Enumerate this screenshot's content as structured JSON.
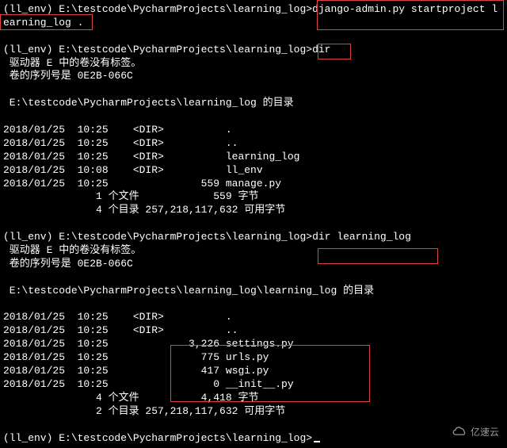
{
  "prompt1_prefix": "(ll_env) E:\\testcode\\PycharmProjects\\learning_log>",
  "cmd1": "django-admin.py startproject l",
  "cmd1_wrap": "earning_log .",
  "prompt2_prefix": "(ll_env) E:\\testcode\\PycharmProjects\\learning_log>",
  "cmd2": "dir",
  "vol_info1": " 驱动器 E 中的卷没有标签。",
  "vol_info2": " 卷的序列号是 0E2B-066C",
  "dir_header1": " E:\\testcode\\PycharmProjects\\learning_log 的目录",
  "listing1": {
    "r1": "2018/01/25  10:25    <DIR>          .",
    "r2": "2018/01/25  10:25    <DIR>          ..",
    "r3": "2018/01/25  10:25    <DIR>          learning_log",
    "r4": "2018/01/25  10:08    <DIR>          ll_env",
    "r5": "2018/01/25  10:25               559 manage.py",
    "summary1": "               1 个文件            559 字节",
    "summary2": "               4 个目录 257,218,117,632 可用字节"
  },
  "prompt3_prefix": "(ll_env) E:\\testcode\\PycharmProjects\\learning_log>",
  "cmd3": "dir learning_log",
  "dir_header2": " E:\\testcode\\PycharmProjects\\learning_log\\learning_log 的目录",
  "listing2": {
    "r1": "2018/01/25  10:25    <DIR>          .",
    "r2": "2018/01/25  10:25    <DIR>          ..",
    "r3": "2018/01/25  10:25             3,226 settings.py",
    "r4": "2018/01/25  10:25               775 urls.py",
    "r5": "2018/01/25  10:25               417 wsgi.py",
    "r6": "2018/01/25  10:25                 0 __init__.py",
    "summary1": "               4 个文件          4,418 字节",
    "summary2": "               2 个目录 257,218,117,632 可用字节"
  },
  "prompt4_prefix": "(ll_env) E:\\testcode\\PycharmProjects\\learning_log>",
  "watermark_text": "亿速云",
  "box": {
    "cmd1": "django-admin startproject",
    "cmd2": "dir",
    "cmd3": "dir learning_log",
    "files": "settings.py urls.py wsgi.py __init__.py"
  }
}
